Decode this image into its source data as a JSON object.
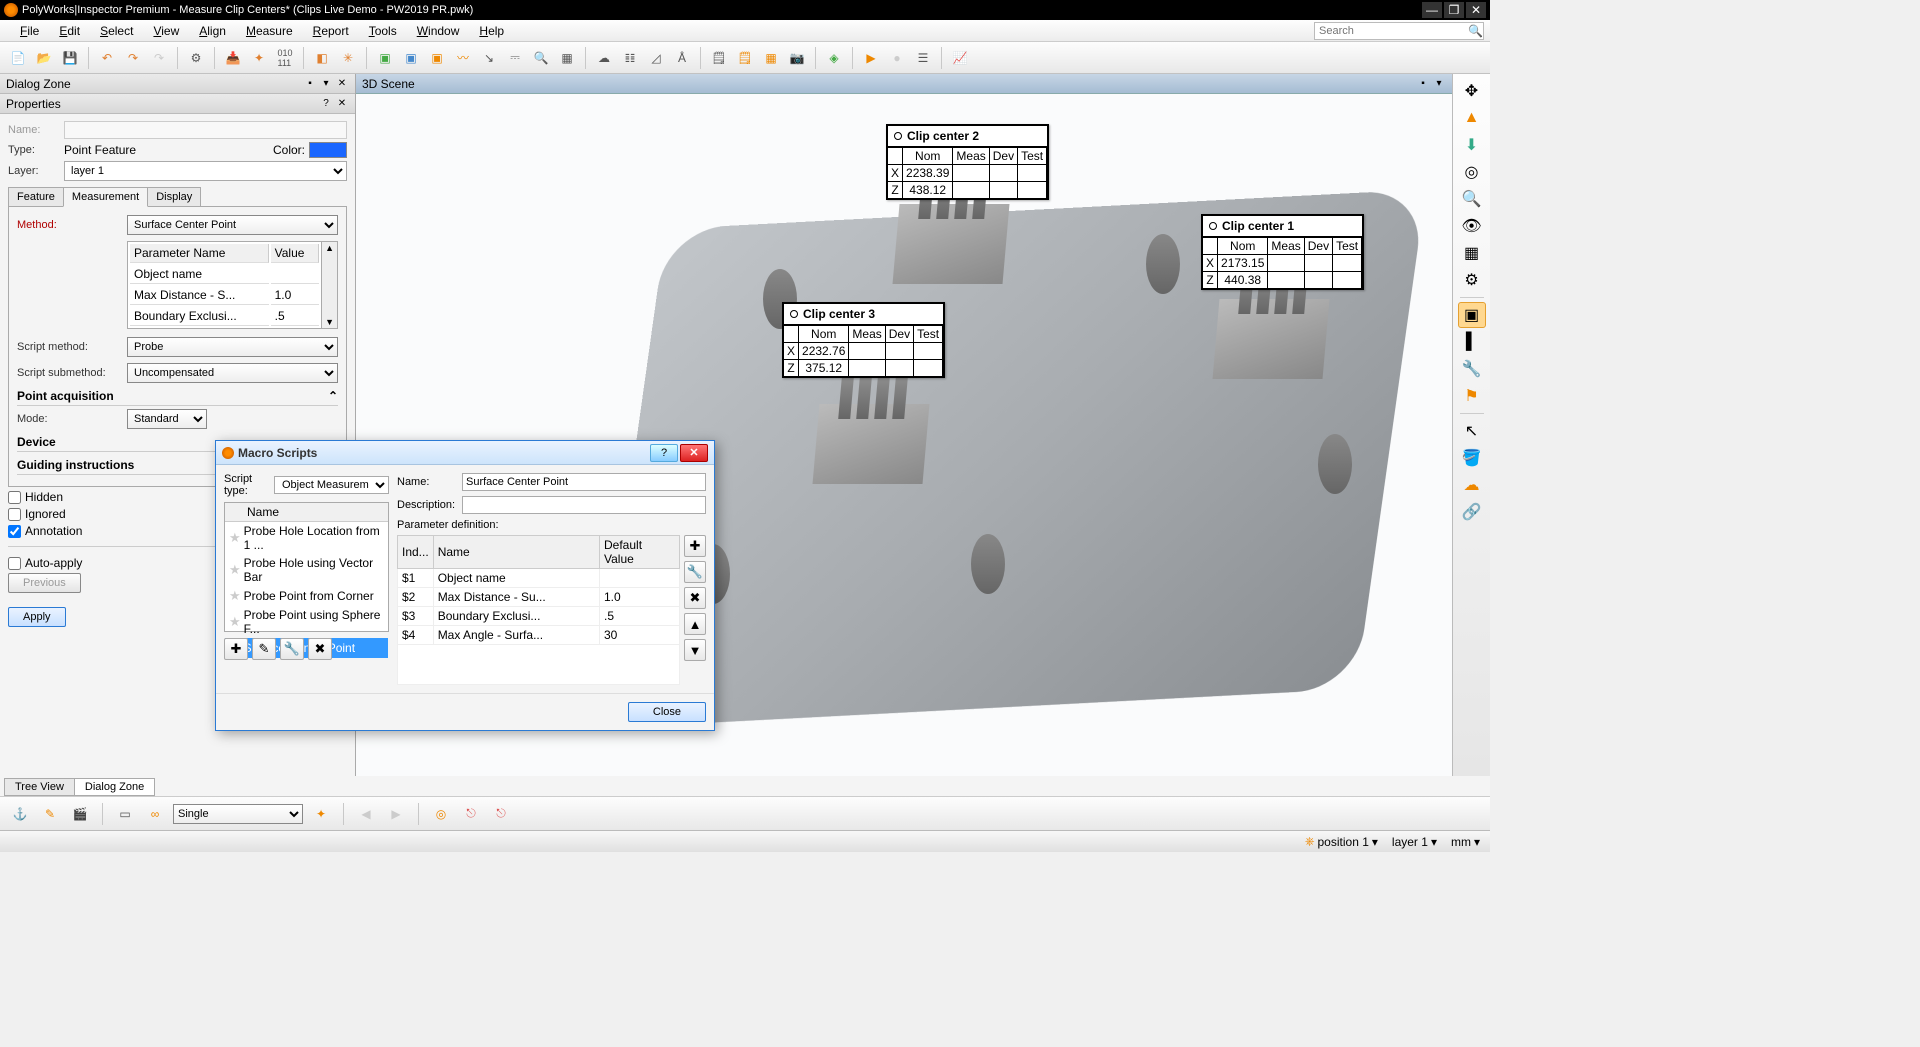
{
  "title": "PolyWorks|Inspector Premium - Measure Clip Centers* (Clips Live Demo - PW2019 PR.pwk)",
  "menu": {
    "file": "File",
    "edit": "Edit",
    "select": "Select",
    "view": "View",
    "align": "Align",
    "measure": "Measure",
    "report": "Report",
    "tools": "Tools",
    "window": "Window",
    "help": "Help",
    "search_placeholder": "Search"
  },
  "dialog_zone": {
    "title": "Dialog Zone"
  },
  "properties": {
    "title": "Properties",
    "name_label": "Name:",
    "name_value": "",
    "type_label": "Type:",
    "type_value": "Point Feature",
    "color_label": "Color:",
    "layer_label": "Layer:",
    "layer_value": "layer 1",
    "tabs": {
      "feature": "Feature",
      "measurement": "Measurement",
      "display": "Display"
    },
    "method_label": "Method:",
    "method_value": "Surface Center Point",
    "param_header_name": "Parameter Name",
    "param_header_value": "Value",
    "params": [
      {
        "name": "Object name",
        "value": ""
      },
      {
        "name": "Max Distance - S...",
        "value": "1.0"
      },
      {
        "name": "Boundary Exclusi...",
        "value": ".5"
      }
    ],
    "script_method_label": "Script method:",
    "script_method_value": "Probe",
    "script_submethod_label": "Script submethod:",
    "script_submethod_value": "Uncompensated",
    "point_acq": "Point acquisition",
    "mode_label": "Mode:",
    "mode_value": "Standard",
    "device": "Device",
    "guiding": "Guiding instructions",
    "hidden": "Hidden",
    "ignored": "Ignored",
    "annotation": "Annotation",
    "auto_apply": "Auto-apply",
    "previous": "Previous",
    "apply": "Apply"
  },
  "scene": {
    "title": "3D Scene",
    "callouts": [
      {
        "title": "Clip center 2",
        "headers": [
          "",
          "Nom",
          "Meas",
          "Dev",
          "Test"
        ],
        "rows": [
          [
            "X",
            "2238.39",
            "",
            "",
            ""
          ],
          [
            "Z",
            "438.12",
            "",
            "",
            ""
          ]
        ]
      },
      {
        "title": "Clip center 1",
        "headers": [
          "",
          "Nom",
          "Meas",
          "Dev",
          "Test"
        ],
        "rows": [
          [
            "X",
            "2173.15",
            "",
            "",
            ""
          ],
          [
            "Z",
            "440.38",
            "",
            "",
            ""
          ]
        ]
      },
      {
        "title": "Clip center 3",
        "headers": [
          "",
          "Nom",
          "Meas",
          "Dev",
          "Test"
        ],
        "rows": [
          [
            "X",
            "2232.76",
            "",
            "",
            ""
          ],
          [
            "Z",
            "375.12",
            "",
            "",
            ""
          ]
        ]
      }
    ]
  },
  "bottom_tabs": {
    "tree": "Tree View",
    "dialog": "Dialog Zone"
  },
  "bottom_toolbar": {
    "mode": "Single"
  },
  "status": {
    "position": "position 1",
    "layer": "layer 1",
    "unit": "mm"
  },
  "macro_dialog": {
    "title": "Macro Scripts",
    "script_type_label": "Script type:",
    "script_type_value": "Object Measurem",
    "list_header": "Name",
    "items": [
      "Probe Hole Location from 1 ...",
      "Probe Hole using Vector Bar",
      "Probe Point from Corner",
      "Probe Point using Sphere F...",
      "Surface Center Point"
    ],
    "name_label": "Name:",
    "name_value": "Surface Center Point",
    "desc_label": "Description:",
    "desc_value": "",
    "param_def_label": "Parameter definition:",
    "param_headers": [
      "Ind...",
      "Name",
      "Default Value"
    ],
    "param_rows": [
      [
        "$1",
        "Object name",
        ""
      ],
      [
        "$2",
        "Max Distance - Su...",
        "1.0"
      ],
      [
        "$3",
        "Boundary Exclusi...",
        ".5"
      ],
      [
        "$4",
        "Max Angle - Surfa...",
        "30"
      ]
    ],
    "close": "Close"
  }
}
